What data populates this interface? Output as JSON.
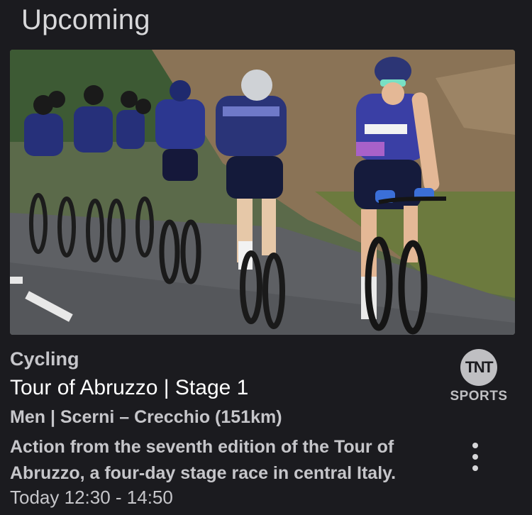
{
  "section": {
    "title": "Upcoming"
  },
  "card": {
    "image_alt": "Cyclists racing on a road",
    "category": "Cycling",
    "title": "Tour of Abruzzo | Stage 1",
    "subtitle": "Men | Scerni – Crecchio (151km)",
    "description": "Action from the seventh edition of the Tour of Abruzzo, a four-day stage race in central Italy.",
    "time": "Today 12:30 - 14:50",
    "channel": {
      "logo_text": "TNT",
      "label": "SPORTS"
    },
    "more_icon": "more-vertical-icon"
  },
  "colors": {
    "background": "#1b1b1f",
    "text_primary": "#ffffff",
    "text_secondary": "#c6c6ca",
    "jersey": "#2b3a8f"
  }
}
